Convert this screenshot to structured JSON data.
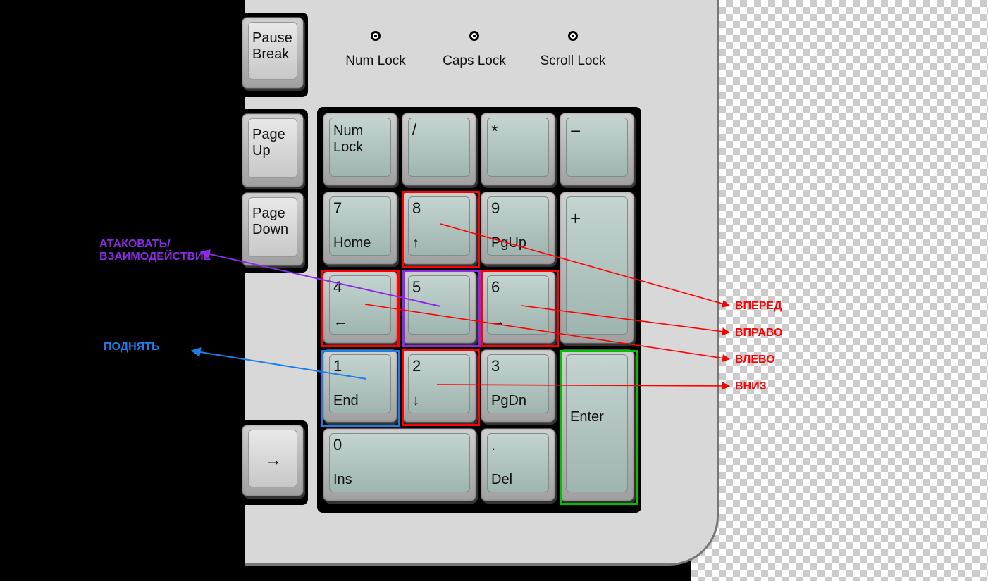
{
  "locks": {
    "num": "Num Lock",
    "caps": "Caps Lock",
    "scroll": "Scroll Lock"
  },
  "side_keys": {
    "pause": "Pause\nBreak",
    "pgup": "Page\nUp",
    "pgdn": "Page\nDown",
    "rarrow": "→"
  },
  "numpad": {
    "numlock": "Num\nLock",
    "slash": "/",
    "star": "*",
    "minus": "−",
    "seven": {
      "m": "7",
      "s": "Home"
    },
    "eight": {
      "m": "8",
      "s": "↑"
    },
    "nine": {
      "m": "9",
      "s": "PgUp"
    },
    "plus": "+",
    "four": {
      "m": "4",
      "s": "←"
    },
    "five": {
      "m": "5",
      "s": ""
    },
    "six": {
      "m": "6",
      "s": "→"
    },
    "one": {
      "m": "1",
      "s": "End"
    },
    "two": {
      "m": "2",
      "s": "↓"
    },
    "three": {
      "m": "3",
      "s": "PgDn"
    },
    "enter": "Enter",
    "zero": {
      "m": "0",
      "s": "Ins"
    },
    "dot": {
      "m": ".",
      "s": "Del"
    }
  },
  "anno": {
    "attack": "АТАКОВАТЬ/\nВЗАИМОДЕЙСТВИЕ",
    "pickup": "ПОДНЯТЬ",
    "forward": "ВПЕРЕД",
    "right": "ВПРАВО",
    "left": "ВЛЕВО",
    "down": "ВНИЗ"
  },
  "colors": {
    "red": "#ff0000",
    "blue": "#1a7fe6",
    "purple": "#8a2be2",
    "green": "#00c000"
  }
}
